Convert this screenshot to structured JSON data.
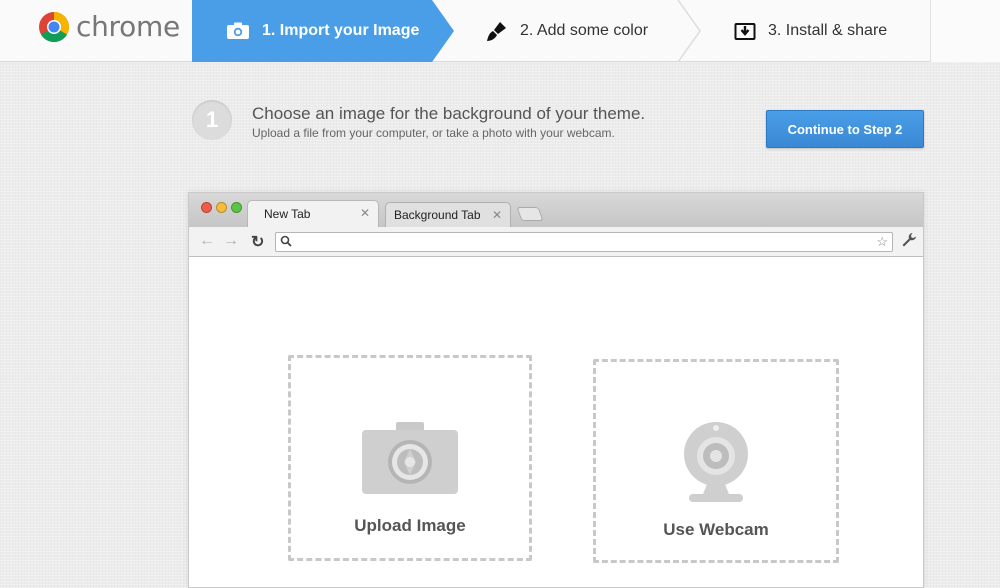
{
  "brand": {
    "name": "chrome"
  },
  "steps": [
    {
      "label": "1. Import your Image",
      "icon": "camera-icon",
      "active": true
    },
    {
      "label": "2. Add some color",
      "icon": "paintbrush-icon",
      "active": false
    },
    {
      "label": "3. Install & share",
      "icon": "download-icon",
      "active": false
    }
  ],
  "instruction": {
    "number": "1",
    "title": "Choose an image for the background of your theme.",
    "subtitle": "Upload a file from your computer, or take a photo with your webcam."
  },
  "continue_button": {
    "label": "Continue to Step 2"
  },
  "browser": {
    "tabs": [
      {
        "label": "New Tab",
        "active": true
      },
      {
        "label": "Background Tab",
        "active": false
      }
    ],
    "omnibox": {
      "value": ""
    }
  },
  "options": {
    "upload": {
      "label": "Upload Image",
      "icon": "camera-icon"
    },
    "webcam": {
      "label": "Use Webcam",
      "icon": "webcam-icon"
    }
  },
  "colors": {
    "accent": "#4a9ee8",
    "active_step": "#4a9ee8",
    "zone_border": "#c8c8c8"
  }
}
